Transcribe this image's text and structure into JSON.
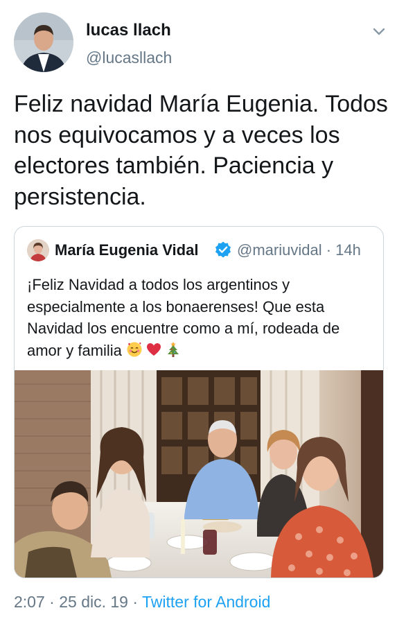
{
  "author": {
    "name": "lucas llach",
    "handle": "@lucasllach",
    "avatar_icon": "profile-photo"
  },
  "tweet": {
    "text": "Feliz navidad María Eugenia. Todos nos equivocamos y a veces los electores también. Paciencia y persistencia."
  },
  "quoted": {
    "name": "María Eugenia Vidal",
    "verified_icon": "verified-badge-icon",
    "handle": "@mariuvidal",
    "separator": "·",
    "time": "14h",
    "text": "¡Feliz Navidad a todos los argentinos y especialmente a los bonaerenses! Que esta Navidad los encuentre como a mí, rodeada de amor y familia",
    "emojis": [
      "smiling-face-with-hearts",
      "red-heart",
      "christmas-tree"
    ],
    "photo": "family-christmas-dinner-photo"
  },
  "meta": {
    "time": "2:07",
    "sep1": "·",
    "date": "25 dic. 19",
    "sep2": "·",
    "source": "Twitter for Android"
  },
  "colors": {
    "text": "#14171a",
    "secondary": "#657786",
    "link": "#1da1f2",
    "border": "#ccd6dd"
  }
}
